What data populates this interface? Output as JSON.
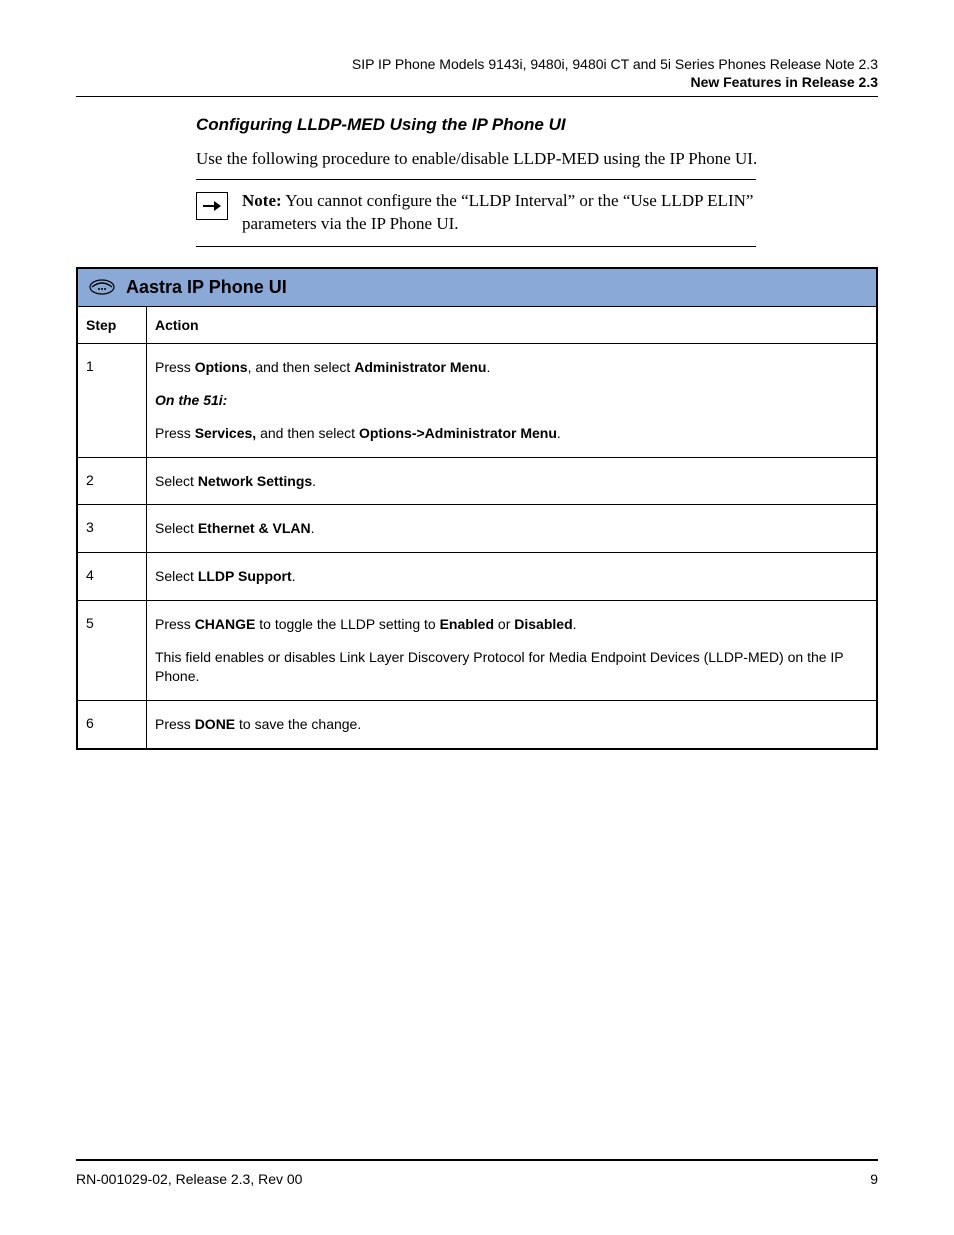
{
  "header": {
    "product_line": "SIP IP Phone Models 9143i, 9480i, 9480i CT and 5i Series Phones Release Note 2.3",
    "section_label": "New Features in Release 2.3"
  },
  "section": {
    "title": "Configuring LLDP-MED Using the IP Phone UI",
    "intro": "Use the following procedure to enable/disable LLDP-MED using the IP Phone UI."
  },
  "note": {
    "label": "Note:",
    "text": " You cannot configure the “LLDP Interval” or the “Use LLDP ELIN” parameters via the IP Phone UI."
  },
  "table": {
    "title": "Aastra IP Phone UI",
    "head_step": "Step",
    "head_action": "Action",
    "rows": [
      {
        "step": "1",
        "lines": [
          {
            "segments": [
              {
                "t": "Press "
              },
              {
                "t": "Options",
                "b": true
              },
              {
                "t": ", and then select "
              },
              {
                "t": "Administrator Menu",
                "b": true
              },
              {
                "t": "."
              }
            ]
          },
          {
            "segments": [
              {
                "t": "On the 51i:",
                "bi": true
              }
            ]
          },
          {
            "segments": [
              {
                "t": "Press "
              },
              {
                "t": "Services,",
                "b": true
              },
              {
                "t": " and then select "
              },
              {
                "t": "Options->Administrator Menu",
                "b": true
              },
              {
                "t": "."
              }
            ]
          }
        ]
      },
      {
        "step": "2",
        "lines": [
          {
            "segments": [
              {
                "t": "Select "
              },
              {
                "t": "Network Settings",
                "b": true
              },
              {
                "t": "."
              }
            ]
          }
        ]
      },
      {
        "step": "3",
        "lines": [
          {
            "segments": [
              {
                "t": "Select "
              },
              {
                "t": "Ethernet & VLAN",
                "b": true
              },
              {
                "t": "."
              }
            ]
          }
        ]
      },
      {
        "step": "4",
        "lines": [
          {
            "segments": [
              {
                "t": "Select "
              },
              {
                "t": "LLDP Support",
                "b": true
              },
              {
                "t": "."
              }
            ]
          }
        ]
      },
      {
        "step": "5",
        "lines": [
          {
            "segments": [
              {
                "t": "Press "
              },
              {
                "t": "CHANGE",
                "b": true
              },
              {
                "t": " to toggle the LLDP setting to "
              },
              {
                "t": "Enabled",
                "b": true
              },
              {
                "t": " or "
              },
              {
                "t": "Disabled",
                "b": true
              },
              {
                "t": "."
              }
            ]
          },
          {
            "segments": [
              {
                "t": "This field enables or disables Link Layer Discovery Protocol for Media Endpoint Devices (LLDP-MED) on the IP Phone."
              }
            ]
          }
        ]
      },
      {
        "step": "6",
        "lines": [
          {
            "segments": [
              {
                "t": "Press "
              },
              {
                "t": "DONE",
                "b": true
              },
              {
                "t": " to save the change."
              }
            ]
          }
        ]
      }
    ]
  },
  "footer": {
    "left": "RN-001029-02, Release 2.3, Rev 00",
    "right": "9"
  }
}
